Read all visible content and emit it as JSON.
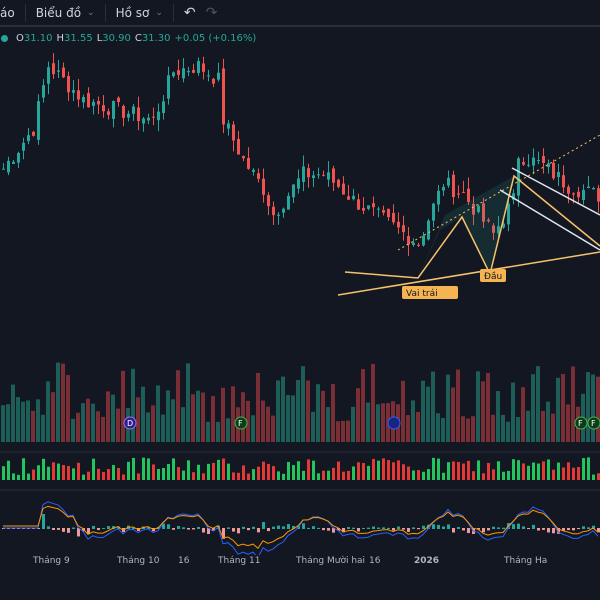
{
  "toolbar": {
    "item_partial": "áo",
    "chart": "Biểu đồ",
    "profile": "Hồ sơ",
    "undo_icon": "undo-icon",
    "redo_icon": "redo-icon"
  },
  "legend": {
    "o_label": "O",
    "o": "31.10",
    "h_label": "H",
    "h": "31.55",
    "l_label": "L",
    "l": "30.90",
    "c_label": "C",
    "c": "31.30",
    "change": "+0.05 (+0.16%)"
  },
  "pattern": {
    "left_shoulder": "Vai trái",
    "head": "Đầu"
  },
  "events": [
    "D",
    "F",
    "F",
    "F"
  ],
  "time_axis": [
    "Tháng 9",
    "Tháng 10",
    "16",
    "Tháng 11",
    "Tháng Mười hai",
    "16",
    "2026",
    "Tháng Ha"
  ],
  "colors": {
    "up": "#26a69a",
    "down": "#ef5350",
    "vol_up": "#1d5e58",
    "vol_down": "#7a2e36",
    "pattern": "#f7c26b"
  },
  "price_anchors": [
    [
      0,
      32.9
    ],
    [
      6,
      34.3
    ],
    [
      9,
      36.5
    ],
    [
      12,
      36.0
    ],
    [
      16,
      35.3
    ],
    [
      20,
      35.1
    ],
    [
      26,
      34.8
    ],
    [
      30,
      34.6
    ],
    [
      34,
      36.3
    ],
    [
      39,
      36.5
    ],
    [
      43,
      36.0
    ],
    [
      44,
      34.6
    ],
    [
      48,
      33.2
    ],
    [
      52,
      32.2
    ],
    [
      54,
      31.3
    ],
    [
      57,
      32.0
    ],
    [
      60,
      32.7
    ],
    [
      64,
      32.7
    ],
    [
      67,
      32.3
    ],
    [
      70,
      31.8
    ],
    [
      76,
      31.1
    ],
    [
      83,
      30.3
    ],
    [
      88,
      32.4
    ],
    [
      92,
      32.0
    ],
    [
      98,
      30.6
    ],
    [
      102,
      31.8
    ],
    [
      103,
      33.4
    ],
    [
      108,
      33.0
    ],
    [
      113,
      32.3
    ],
    [
      120,
      31.9
    ]
  ]
}
